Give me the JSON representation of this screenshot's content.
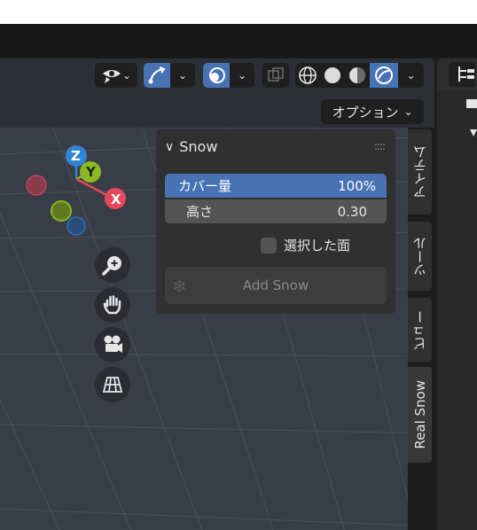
{
  "header": {
    "options_label": "オプション",
    "options_chevron": "⌄",
    "buttons": [
      {
        "name": "visibility-icon",
        "chevron": "⌄"
      },
      {
        "name": "gizmo-icon",
        "chevron": "⌄"
      },
      {
        "name": "overlay-icon",
        "chevron": "⌄"
      },
      {
        "name": "xray-icon"
      },
      {
        "name": "shading-wireframe-icon"
      },
      {
        "name": "shading-solid-icon"
      },
      {
        "name": "shading-material-icon"
      },
      {
        "name": "shading-rendered-icon",
        "chevron": "⌄"
      }
    ]
  },
  "gizmo": {
    "z_label": "Z",
    "y_label": "Y",
    "x_label": "X",
    "colors": {
      "x": "#e6475c",
      "y": "#8bb824",
      "z": "#2e85d4"
    }
  },
  "nav_tools": [
    "zoom-icon",
    "hand-icon",
    "camera-icon",
    "grid-icon"
  ],
  "panel": {
    "title": "Snow",
    "chevron": "∨",
    "cover_label": "カバー量",
    "cover_value": "100%",
    "height_label": "高さ",
    "height_value": "0.30",
    "selected_faces_label": "選択した面",
    "add_button_label": "Add Snow",
    "add_icon": "❄"
  },
  "tabs": [
    {
      "label": "アイテム"
    },
    {
      "label": "ツール"
    },
    {
      "label": "ビュー"
    },
    {
      "label": "Real Snow",
      "active": true
    }
  ],
  "colors": {
    "accent": "#4772b3",
    "viewport": "#393d47",
    "panel": "#303030"
  }
}
